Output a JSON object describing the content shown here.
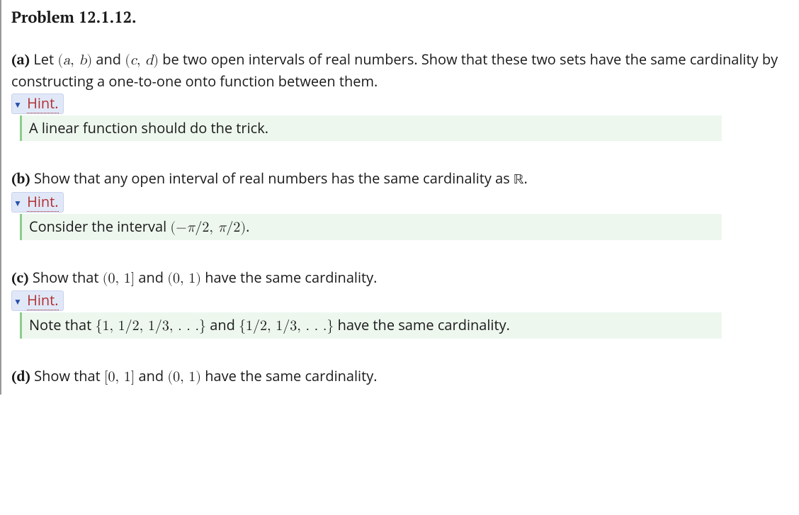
{
  "problem": {
    "title": "Problem 12.1.12.",
    "parts": [
      {
        "label": "(a)",
        "text_pre": "  Let ",
        "math1": "(a, b)",
        "mid1": " and ",
        "math2": "(c, d)",
        "text_post": " be two open intervals of real numbers. Show that these two sets have the same cardinality by constructing a one-to-one onto function between them.",
        "hint_label": "Hint.",
        "hint_text": "A linear function should do the trick."
      },
      {
        "label": "(b)",
        "text_pre": "  Show that any open interval of real numbers has the same cardinality as ",
        "math1": "ℝ",
        "text_post": ".",
        "hint_label": "Hint.",
        "hint_pre": "Consider the interval ",
        "hint_math": "(−π/2, π/2)",
        "hint_post": "."
      },
      {
        "label": "(c)",
        "text_pre": "  Show that ",
        "math1": "(0, 1]",
        "mid1": " and ",
        "math2": "(0, 1)",
        "text_post": " have the same cardinality.",
        "hint_label": "Hint.",
        "hint_pre": "Note that ",
        "hint_math1": "{1, 1/2, 1/3, . . .}",
        "hint_mid": " and ",
        "hint_math2": "{1/2, 1/3, . . .}",
        "hint_post": " have the same cardinality."
      },
      {
        "label": "(d)",
        "text_pre": "  Show that ",
        "math1": "[0, 1]",
        "mid1": " and ",
        "math2": "(0, 1)",
        "text_post": " have the same cardinality."
      }
    ]
  }
}
